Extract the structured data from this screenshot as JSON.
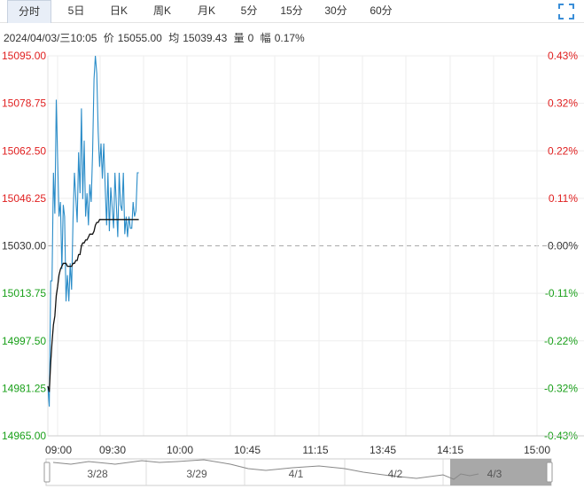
{
  "tabs": [
    {
      "label": "分时",
      "active": true
    },
    {
      "label": "5日"
    },
    {
      "label": "日K"
    },
    {
      "label": "周K"
    },
    {
      "label": "月K"
    },
    {
      "label": "5分"
    },
    {
      "label": "15分"
    },
    {
      "label": "30分"
    },
    {
      "label": "60分"
    }
  ],
  "info": {
    "datetime": "2024/04/03/三10:05",
    "price_label": "价",
    "price": "15055.00",
    "avg_label": "均",
    "avg": "15039.43",
    "vol_label": "量",
    "vol": "0",
    "chg_label": "幅",
    "chg": "0.17%"
  },
  "colors": {
    "up": "#e02020",
    "down": "#1aa01a",
    "flat": "#333333",
    "price_line": "#2a8cc8",
    "avg_line": "#111111"
  },
  "chart_data": {
    "type": "line",
    "prev_close": 15030.0,
    "ylim": [
      14965.0,
      15095.0
    ],
    "y_ticks": [
      "15095.00",
      "15078.75",
      "15062.50",
      "15046.25",
      "15030.00",
      "15013.75",
      "14997.50",
      "14981.25",
      "14965.00"
    ],
    "pct_ticks": [
      "0.43%",
      "0.32%",
      "0.22%",
      "0.11%",
      "0.00%",
      "-0.11%",
      "-0.22%",
      "-0.32%",
      "-0.43%"
    ],
    "x_ticks": [
      "09:00",
      "09:30",
      "10:00",
      "10:45",
      "11:15",
      "13:45",
      "14:15",
      "15:00"
    ],
    "session_minutes": 360,
    "series": [
      {
        "key": "price",
        "minutes": [
          0,
          1,
          2,
          3,
          4,
          5,
          6,
          7,
          8,
          9,
          10,
          11,
          12,
          13,
          14,
          15,
          16,
          17,
          18,
          19,
          20,
          21,
          22,
          23,
          24,
          25,
          26,
          27,
          28,
          29,
          30,
          31,
          32,
          33,
          34,
          35,
          36,
          37,
          38,
          39,
          40,
          41,
          42,
          43,
          44,
          45,
          46,
          47,
          48,
          49,
          50,
          51,
          52,
          53,
          54,
          55,
          56,
          57,
          58,
          59,
          60,
          61,
          62,
          63,
          64,
          65
        ],
        "values": [
          14982,
          14975,
          15018,
          15018,
          15055,
          15041,
          15080,
          15060,
          15040,
          15045,
          15022,
          15044,
          15040,
          15011,
          15020,
          15011,
          15024,
          15015,
          15039,
          15055,
          15046,
          15038,
          15062,
          15048,
          15077,
          15046,
          15066,
          15040,
          15048,
          15037,
          15051,
          15045,
          15062,
          15087,
          15095,
          15089,
          15069,
          15057,
          15065,
          15053,
          15065,
          15050,
          15037,
          15055,
          15035,
          15050,
          15043,
          15036,
          15055,
          15044,
          15033,
          15055,
          15044,
          15042,
          15055,
          15034,
          15040,
          15033,
          15040,
          15036,
          15036,
          15045,
          15040,
          15042,
          15055,
          15055
        ]
      },
      {
        "key": "avg",
        "minutes": [
          0,
          1,
          2,
          3,
          4,
          5,
          6,
          7,
          8,
          9,
          10,
          11,
          12,
          13,
          14,
          15,
          16,
          17,
          18,
          19,
          20,
          21,
          22,
          23,
          24,
          25,
          26,
          27,
          28,
          29,
          30,
          31,
          32,
          33,
          34,
          35,
          36,
          37,
          38,
          39,
          40,
          41,
          42,
          43,
          44,
          45,
          46,
          47,
          48,
          49,
          50,
          51,
          52,
          53,
          54,
          55,
          56,
          57,
          58,
          59,
          60,
          61,
          62,
          63,
          64,
          65
        ],
        "values": [
          14982,
          14980,
          14990,
          14997,
          15003,
          15006,
          15013,
          15016,
          15020,
          15022,
          15023,
          15024,
          15024,
          15024,
          15023,
          15023,
          15023,
          15023,
          15024,
          15024,
          15025,
          15025,
          15027,
          15027,
          15030,
          15031,
          15031,
          15032,
          15032,
          15033,
          15034,
          15034,
          15034,
          15035,
          15037,
          15038,
          15038,
          15039,
          15039,
          15039,
          15039,
          15039,
          15039,
          15039,
          15039,
          15039,
          15039,
          15039,
          15039,
          15039,
          15039,
          15039,
          15039,
          15039,
          15039,
          15039,
          15039,
          15039,
          15039,
          15039,
          15039,
          15039,
          15039,
          15039,
          15039,
          15039
        ]
      }
    ],
    "navigator": {
      "labels": [
        "3/28",
        "3/29",
        "4/1",
        "4/2",
        "4/3"
      ]
    }
  }
}
